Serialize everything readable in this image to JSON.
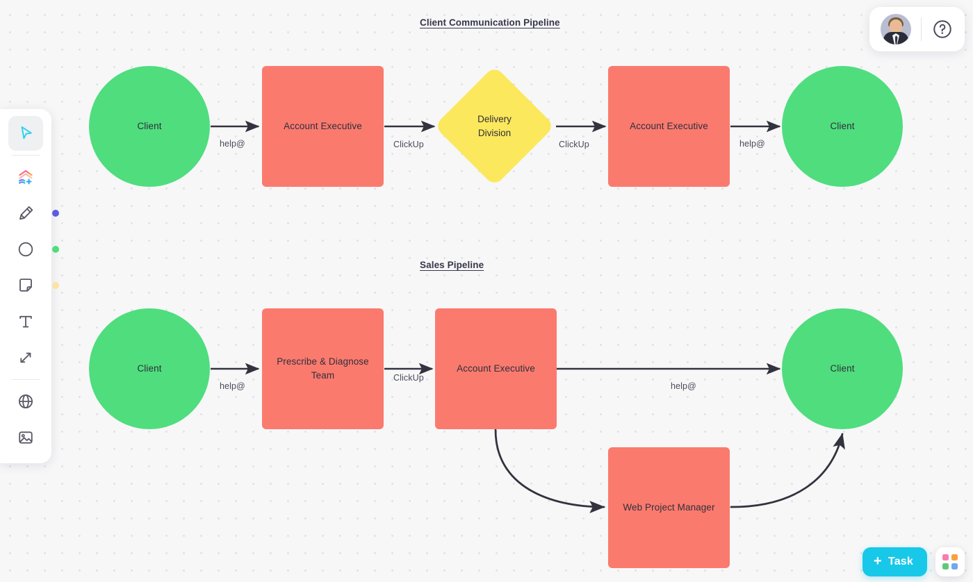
{
  "app": {
    "title": "Whiteboard Canvas",
    "background_color": "#f7f7f8",
    "dot_color": "#e1e1e6"
  },
  "palette": {
    "green": "#4FDD7E",
    "salmon": "#FB7A6E",
    "yellow": "#FBE85C",
    "text": "#2f2f3b",
    "edge": "#33333f",
    "accent_cyan": "#18c8e8"
  },
  "sections": [
    {
      "id": "client-communication-pipeline",
      "title": "Client Communication Pipeline"
    },
    {
      "id": "sales-pipeline",
      "title": "Sales Pipeline"
    }
  ],
  "nodes": {
    "n1": {
      "label": "Client",
      "shape": "circle",
      "color": "#4FDD7E"
    },
    "n2": {
      "label": "Account Executive",
      "shape": "rect",
      "color": "#FB7A6E"
    },
    "n3": {
      "label": "Delivery\nDivision",
      "line1": "Delivery",
      "line2": "Division",
      "shape": "diamond",
      "color": "#FBE85C"
    },
    "n4": {
      "label": "Account Executive",
      "shape": "rect",
      "color": "#FB7A6E"
    },
    "n5": {
      "label": "Client",
      "shape": "circle",
      "color": "#4FDD7E"
    },
    "n6": {
      "label": "Client",
      "shape": "circle",
      "color": "#4FDD7E"
    },
    "n7": {
      "label": "Prescribe & Diagnose Team",
      "line1": "Prescribe & Diagnose",
      "line2": "Team",
      "shape": "rect",
      "color": "#FB7A6E"
    },
    "n8": {
      "label": "Account Executive",
      "shape": "rect",
      "color": "#FB7A6E"
    },
    "n9": {
      "label": "Client",
      "shape": "circle",
      "color": "#4FDD7E"
    },
    "n10": {
      "label": "Web Project Manager",
      "shape": "rect",
      "color": "#FB7A6E"
    }
  },
  "edge_labels": {
    "e1": "help@",
    "e2": "ClickUp",
    "e3": "ClickUp",
    "e4": "help@",
    "e5": "help@",
    "e6": "ClickUp",
    "e7": "help@"
  },
  "toolbar": {
    "items": [
      {
        "name": "select-tool",
        "icon": "cursor-icon",
        "label": "Select",
        "active": true,
        "dot": null
      },
      {
        "name": "shapes-tool",
        "icon": "add-shape-icon",
        "label": "Add shape",
        "active": false,
        "dot": null
      },
      {
        "name": "pen-tool",
        "icon": "pen-icon",
        "label": "Pen",
        "active": false,
        "dot": "#5b5be6"
      },
      {
        "name": "circle-tool",
        "icon": "circle-icon",
        "label": "Shape",
        "active": false,
        "dot": "#4FDD7E"
      },
      {
        "name": "note-tool",
        "icon": "sticky-note-icon",
        "label": "Sticky note",
        "active": false,
        "dot": "#fbe3a2"
      },
      {
        "name": "text-tool",
        "icon": "text-icon",
        "label": "Text",
        "active": false,
        "dot": null
      },
      {
        "name": "connector-tool",
        "icon": "connector-icon",
        "label": "Connector",
        "active": false,
        "dot": null
      },
      {
        "name": "embed-tool",
        "icon": "globe-icon",
        "label": "Embed",
        "active": false,
        "dot": null
      },
      {
        "name": "image-tool",
        "icon": "image-icon",
        "label": "Image",
        "active": false,
        "dot": null
      }
    ]
  },
  "topbar": {
    "avatar_label": "User avatar",
    "help_label": "?"
  },
  "bottombar": {
    "task_label": "Task",
    "task_plus": "+",
    "apps_label": "Apps",
    "app_colors": [
      "#f97bb0",
      "#f7a13f",
      "#5fc97a",
      "#6fa8f0"
    ]
  }
}
